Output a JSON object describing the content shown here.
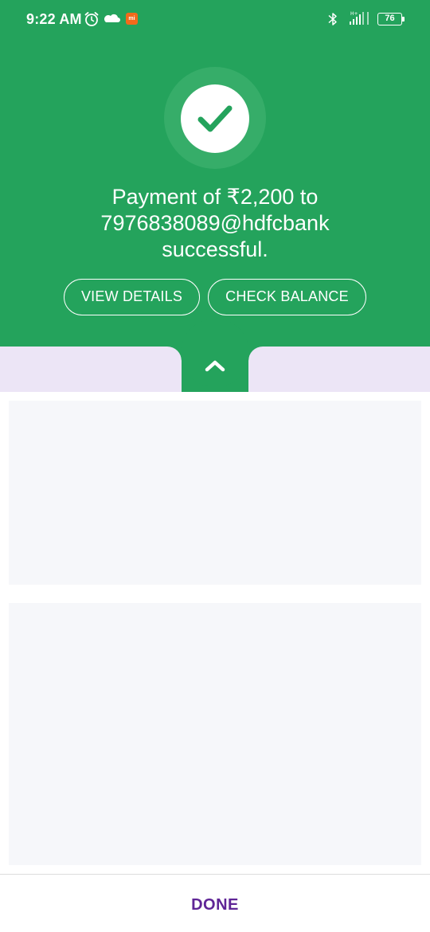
{
  "status_bar": {
    "time": "9:22 AM",
    "icons": [
      "alarm-icon",
      "cloud-icon",
      "mi-icon",
      "bluetooth-icon",
      "signal-icon",
      "battery-icon"
    ],
    "mi_badge": "mi",
    "battery_level": "76"
  },
  "success": {
    "icon": "check-icon",
    "message_line1": "Payment of ₹2,200 to",
    "message_line2": "7976838089@hdfcbank",
    "message_line3": "successful.",
    "view_details_label": "VIEW DETAILS",
    "check_balance_label": "CHECK BALANCE"
  },
  "expander": {
    "icon": "chevron-up-icon"
  },
  "footer": {
    "done_label": "DONE"
  },
  "colors": {
    "header_green": "#24a35c",
    "halo_green": "#36ad69",
    "strip_lavender": "#ece5f6",
    "card_bg": "#f6f7fa",
    "done_purple": "#5f2596"
  }
}
